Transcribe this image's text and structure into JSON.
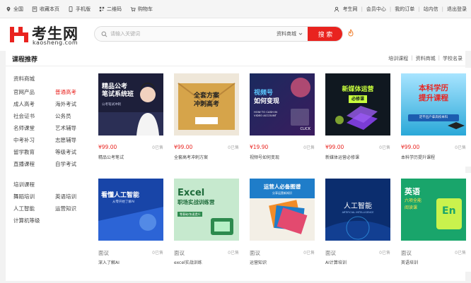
{
  "topbar": {
    "left": [
      {
        "icon": "location-icon",
        "label": "全国"
      },
      {
        "icon": "star-icon",
        "label": "收藏本页"
      },
      {
        "icon": "phone-icon",
        "label": "手机版"
      },
      {
        "icon": "qrcode-icon",
        "label": "二维码"
      },
      {
        "icon": "cart-icon",
        "label": "购物车"
      }
    ],
    "right": [
      "考生网",
      "会员中心",
      "我的订单",
      "站内信",
      "退出登录"
    ]
  },
  "logo": {
    "name": "考生网",
    "domain": "kaosheng.com"
  },
  "search": {
    "placeholder": "请输入关键词",
    "category": "资料商城",
    "button": "搜 索"
  },
  "panel": {
    "title": "课程推荐",
    "links": [
      "培训课程",
      "资料商城",
      "学校名录"
    ]
  },
  "sidebar": {
    "group1_title": "资料商城",
    "group1_items": [
      "官网产品",
      "普通高考",
      "成人高考",
      "海外考试",
      "社会证书",
      "公务员",
      "名师课堂",
      "艺术辅导",
      "中考补习",
      "志愿辅导",
      "留学教育",
      "等级考试",
      "直播课程",
      "自学考试"
    ],
    "group2_title": "培训课程",
    "group2_items": [
      "舞蹈培训",
      "英语培训",
      "人工智能",
      "运营知识",
      "计算机等级"
    ]
  },
  "courses": [
    {
      "price": "¥99.00",
      "sold": "0已售",
      "name": "精品公考笔试",
      "cover_lines": [
        "精品公考",
        "笔试系统班"
      ],
      "cover_sub": "公考笔试冲刺",
      "bg": "#1d1f3a"
    },
    {
      "price": "¥99.00",
      "sold": "0已售",
      "name": "全套高考冲刺方案",
      "cover_lines": [
        "全套方案",
        "冲刺高考"
      ],
      "bg": "#d9a84e"
    },
    {
      "price": "¥19.90",
      "sold": "0已售",
      "name": "视频号如何变现",
      "cover_lines": [
        "视频号",
        "如何变现"
      ],
      "cover_sub": "HOW TO CASH IN VIDEO ACCOUNT",
      "cover_tag": "CLICK",
      "bg": "#1a2a5e"
    },
    {
      "price": "¥99.00",
      "sold": "0已售",
      "name": "新媒体运营必修课",
      "cover_lines": [
        "新媒体运营",
        "必修课"
      ],
      "bg": "#101820"
    },
    {
      "price": "¥99.00",
      "sold": "0已售",
      "name": "本科学历提升课程",
      "cover_lines": [
        "本科学历",
        "提升课程"
      ],
      "cover_sub": "足不出户拿高校本科",
      "bg": "#2aa8d8"
    },
    {
      "price": "面议",
      "sold": "0已售",
      "name": "深入了解AI",
      "cover_lines": [
        "看懂人工智能"
      ],
      "cover_sub": "从零开始了解AI",
      "bg": "#1845a8"
    },
    {
      "price": "面议",
      "sold": "0已售",
      "name": "excel实战训练",
      "cover_lines": [
        "Excel",
        "职场实战训练营"
      ],
      "cover_sub": "零基础/快速提升",
      "bg": "#5fc27a"
    },
    {
      "price": "面议",
      "sold": "0已售",
      "name": "运营知识",
      "cover_lines": [
        "运营人必备图谱"
      ],
      "cover_sub": "分享运营新知识",
      "bg": "#1f7dc9"
    },
    {
      "price": "面议",
      "sold": "0已售",
      "name": "AI计算培训",
      "cover_lines": [
        "人工智能"
      ],
      "cover_sub": "ARTIFICIAL INTELLIGENCE",
      "bg": "#0b2d6e"
    },
    {
      "price": "面议",
      "sold": "0已售",
      "name": "英语培训",
      "cover_lines": [
        "英语",
        "六项全能",
        "阅读课"
      ],
      "cover_tag": "En",
      "bg": "#19a56b"
    }
  ],
  "colors": {
    "accent": "#e9231f",
    "text": "#333333",
    "muted": "#aaaaaa"
  }
}
